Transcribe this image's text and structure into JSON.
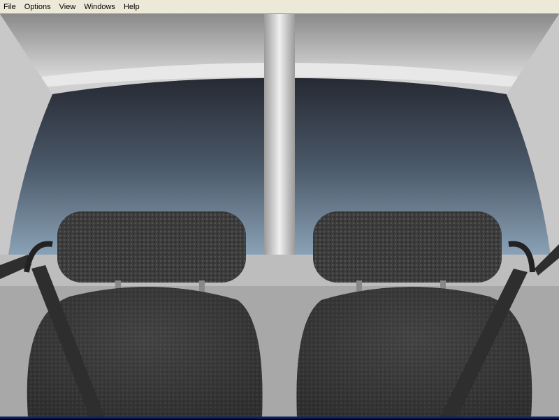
{
  "menu": {
    "items": [
      {
        "label": "File"
      },
      {
        "label": "Options"
      },
      {
        "label": "View"
      },
      {
        "label": "Windows"
      },
      {
        "label": "Help"
      }
    ]
  },
  "colors": {
    "menubar": "#ece9d8",
    "sky_top": "#262a33",
    "sky_bottom": "#7f97ab",
    "trim": "#d4d4d4",
    "fabric": "#3a3a3a"
  }
}
